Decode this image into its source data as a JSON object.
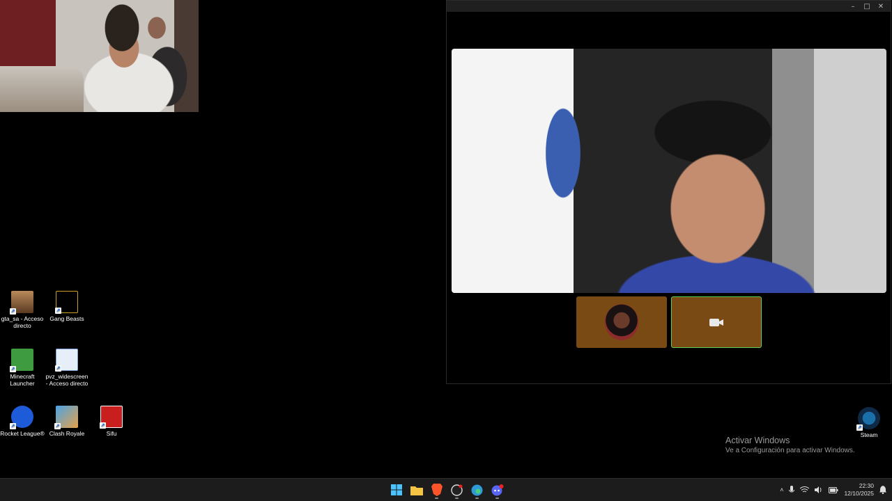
{
  "desktop_icons": [
    {
      "label": "gta_sa - Acceso directo",
      "icon": "gta-sa-icon"
    },
    {
      "label": "Gang Beasts",
      "icon": "gang-beasts-icon"
    },
    {
      "label": "Minecraft Launcher",
      "icon": "minecraft-icon"
    },
    {
      "label": "pvz_widescreen - Acceso directo",
      "icon": "pvz-icon"
    },
    {
      "label": "Rocket League®",
      "icon": "rocket-league-icon"
    },
    {
      "label": "Clash Royale",
      "icon": "clash-royale-icon"
    },
    {
      "label": "Sifu",
      "icon": "sifu-icon"
    },
    {
      "label": "Steam",
      "icon": "steam-icon"
    }
  ],
  "call_window": {
    "controls": {
      "minimize": "–",
      "maximize": "□",
      "close": "✕"
    },
    "thumbnail_accent": "#7a4a14",
    "active_border": "#5ad05a"
  },
  "watermark": {
    "title": "Activar Windows",
    "subtitle": "Ve a Configuración para activar Windows."
  },
  "taskbar": {
    "apps": [
      "windows-start-icon",
      "file-explorer-icon",
      "brave-browser-icon",
      "obs-icon",
      "edge-icon",
      "discord-icon"
    ],
    "clock_time": "22:30",
    "clock_date": "12/10/2025"
  }
}
